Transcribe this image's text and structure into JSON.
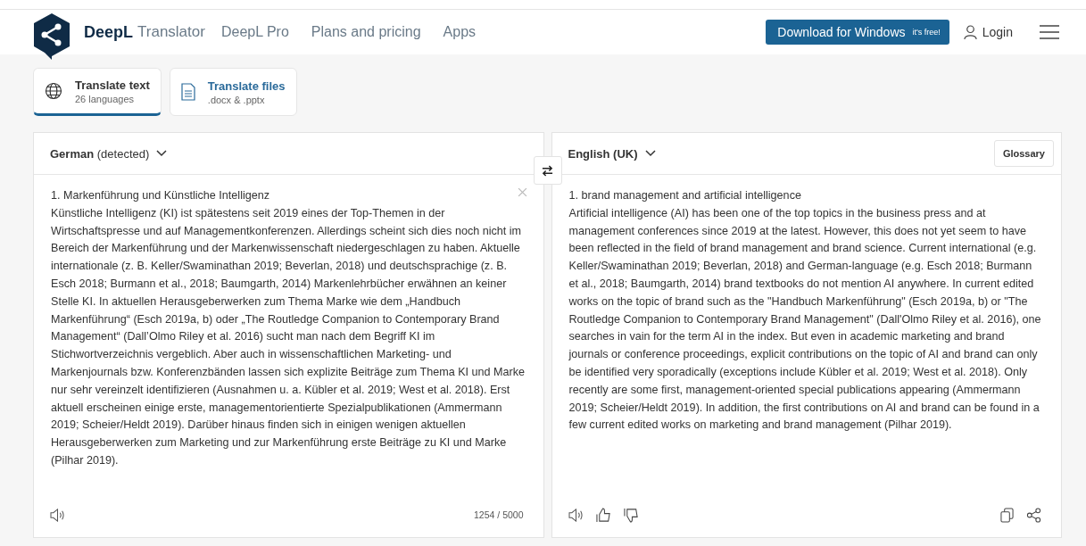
{
  "header": {
    "brand": "DeepL",
    "product": "Translator",
    "nav": [
      "DeepL Pro",
      "Plans and pricing",
      "Apps"
    ],
    "download_button": {
      "label": "Download for Windows",
      "note": "it's free!"
    },
    "login": "Login"
  },
  "modes": [
    {
      "kind": "text",
      "title": "Translate text",
      "subtitle": "26 languages",
      "selected": true
    },
    {
      "kind": "files",
      "title": "Translate files",
      "subtitle": ".docx & .pptx",
      "selected": false
    }
  ],
  "source": {
    "language": "German",
    "detected": "(detected)",
    "heading": "1. Markenführung und Künstliche Intelligenz",
    "text": "Künstliche Intelligenz (KI) ist spätestens seit 2019 eines der Top-Themen in der Wirtschaftspresse und auf Managementkonferenzen. Allerdings scheint sich dies noch nicht im Bereich der Markenführung und der Markenwissenschaft niedergeschlagen zu haben. Aktuelle internationale (z. B. Keller/Swaminathan 2019; Beverlan, 2018) und deutschsprachige (z. B. Esch 2018; Burmann et al., 2018; Baumgarth, 2014) Markenlehrbücher erwähnen an keiner Stelle KI. In aktuellen Herausgeberwerken zum Thema Marke wie dem „Handbuch Markenführung“ (Esch 2019a, b) oder „The Routledge Companion to Contemporary Brand Management“ (Dall’Olmo Riley et al. 2016) sucht man nach dem Begriff KI im Stichwortverzeichnis vergeblich. Aber auch in wissenschaftlichen Marketing- und Markenjournals bzw. Konferenzbänden lassen sich explizite Beiträge zum Thema KI und Marke nur sehr vereinzelt identifizieren (Ausnahmen u. a. Kübler et al. 2019; West et al. 2018). Erst aktuell erscheinen einige erste, managementorientierte Spezialpublikationen (Ammermann 2019; Scheier/Heldt 2019). Darüber hinaus finden sich in einigen wenigen aktuellen Herausgeberwerken zum Marketing und zur Markenführung erste Beiträge zu KI und Marke (Pilhar 2019).",
    "char_count": "1254 / 5000"
  },
  "target": {
    "language": "English (UK)",
    "glossary": "Glossary",
    "heading": "1. brand management and artificial intelligence",
    "text": "Artificial intelligence (AI) has been one of the top topics in the business press and at management conferences since 2019 at the latest. However, this does not yet seem to have been reflected in the field of brand management and brand science. Current international (e.g. Keller/Swaminathan 2019; Beverlan, 2018) and German-language (e.g. Esch 2018; Burmann et al., 2018; Baumgarth, 2014) brand textbooks do not mention AI anywhere. In current edited works on the topic of brand such as the \"Handbuch Markenführung\" (Esch 2019a, b) or \"The Routledge Companion to Contemporary Brand Management\" (Dall'Olmo Riley et al. 2016), one searches in vain for the term AI in the index. But even in academic marketing and brand journals or conference proceedings, explicit contributions on the topic of AI and brand can only be identified very sporadically (exceptions include Kübler et al. 2019; West et al. 2018). Only recently are some first, management-oriented special publications appearing (Ammermann 2019; Scheier/Heldt 2019). In addition, the first contributions on AI and brand can be found in a few current edited works on marketing and brand management (Pilhar 2019)."
  }
}
